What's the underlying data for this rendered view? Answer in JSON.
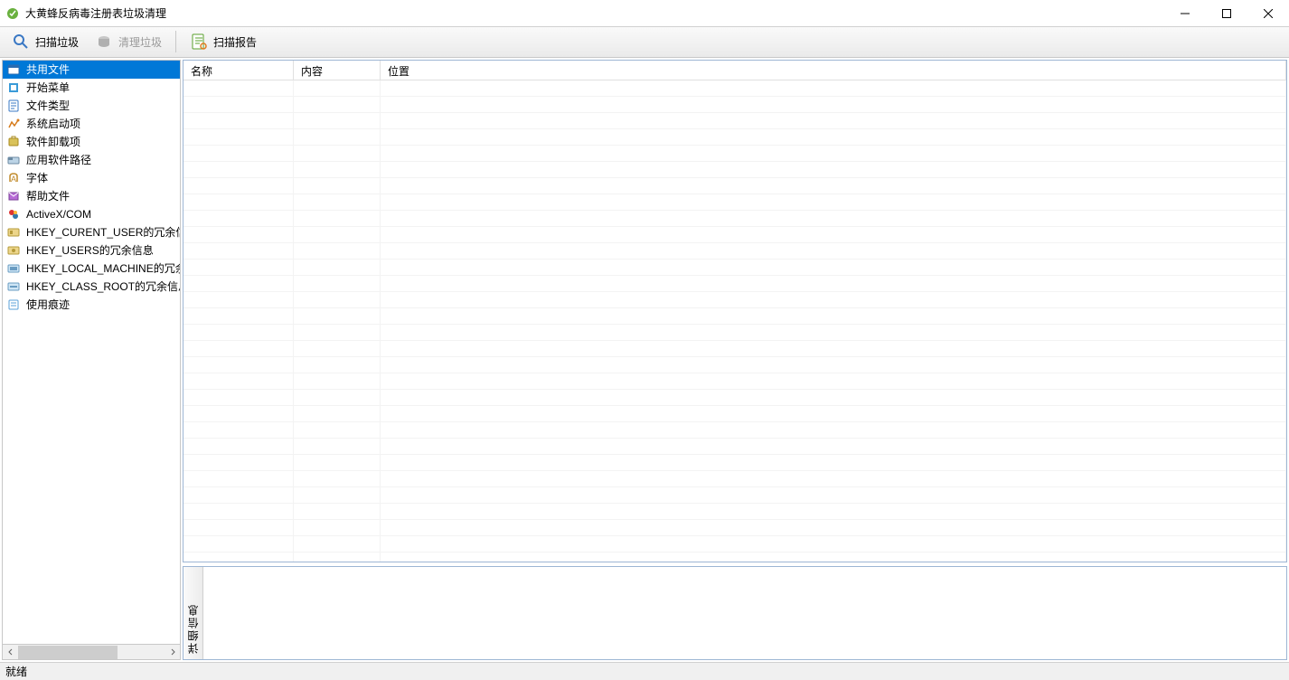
{
  "window": {
    "title": "大黄蜂反病毒注册表垃圾清理"
  },
  "toolbar": {
    "scan_label": "扫描垃圾",
    "clean_label": "清理垃圾",
    "report_label": "扫描报告"
  },
  "sidebar": {
    "items": [
      {
        "label": "共用文件",
        "selected": true
      },
      {
        "label": "开始菜单",
        "selected": false
      },
      {
        "label": "文件类型",
        "selected": false
      },
      {
        "label": "系统启动项",
        "selected": false
      },
      {
        "label": "软件卸载项",
        "selected": false
      },
      {
        "label": "应用软件路径",
        "selected": false
      },
      {
        "label": "字体",
        "selected": false
      },
      {
        "label": "帮助文件",
        "selected": false
      },
      {
        "label": "ActiveX/COM",
        "selected": false
      },
      {
        "label": "HKEY_CURENT_USER的冗余信息",
        "selected": false
      },
      {
        "label": "HKEY_USERS的冗余信息",
        "selected": false
      },
      {
        "label": "HKEY_LOCAL_MACHINE的冗余信息",
        "selected": false
      },
      {
        "label": "HKEY_CLASS_ROOT的冗余信息",
        "selected": false
      },
      {
        "label": "使用痕迹",
        "selected": false
      }
    ]
  },
  "table": {
    "columns": [
      "名称",
      "内容",
      "位置"
    ],
    "rows": []
  },
  "detail": {
    "tab_label": "详细信息"
  },
  "statusbar": {
    "text": "就绪"
  }
}
